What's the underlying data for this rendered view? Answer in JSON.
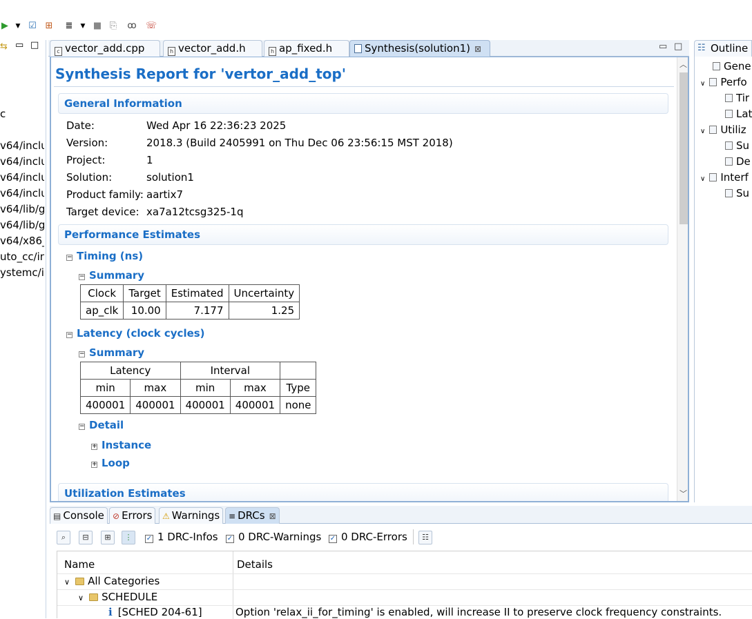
{
  "toolbar": {
    "run_icon": "▶",
    "dropdown_icon": "▼",
    "check_icon": "☑",
    "grid_icon": "⊞",
    "report_icon": "≣",
    "stop_icon": "■",
    "compare_icon": "⎘",
    "glasses_icon": "ꝏ",
    "chat_icon": "☏"
  },
  "left_pane": {
    "lines": [
      "c",
      "v64/inclu",
      "v64/inclu",
      "v64/inclu",
      "v64/inclu",
      "v64/lib/g",
      "v64/lib/g",
      "v64/x86_",
      "uto_cc/in",
      "ystemc/ir"
    ]
  },
  "editor_tabs": [
    {
      "label": "vector_add.cpp",
      "icon": "c"
    },
    {
      "label": "vector_add.h",
      "icon": "h"
    },
    {
      "label": "ap_fixed.h",
      "icon": "h"
    },
    {
      "label": "Synthesis(solution1)",
      "icon": "report",
      "active": true
    }
  ],
  "report": {
    "title": "Synthesis Report for 'vertor_add_top'",
    "general": {
      "header": "General Information",
      "rows": [
        {
          "label": "Date:",
          "value": "Wed Apr 16 22:36:23 2025"
        },
        {
          "label": "Version:",
          "value": "2018.3 (Build 2405991 on Thu Dec 06 23:56:15 MST 2018)"
        },
        {
          "label": "Project:",
          "value": "1"
        },
        {
          "label": "Solution:",
          "value": "solution1"
        },
        {
          "label": "Product family:",
          "value": "aartix7"
        },
        {
          "label": "Target device:",
          "value": "xa7a12tcsg325-1q"
        }
      ]
    },
    "performance": {
      "header": "Performance Estimates",
      "timing_header": "Timing (ns)",
      "summary_label": "Summary",
      "timing_cols": [
        "Clock",
        "Target",
        "Estimated",
        "Uncertainty"
      ],
      "timing_row": [
        "ap_clk",
        "10.00",
        "7.177",
        "1.25"
      ],
      "latency_header": "Latency (clock cycles)",
      "latency_group_cols": [
        "Latency",
        "Interval"
      ],
      "latency_cols": [
        "min",
        "max",
        "min",
        "max",
        "Type"
      ],
      "latency_row": [
        "400001",
        "400001",
        "400001",
        "400001",
        "none"
      ],
      "detail_label": "Detail",
      "instance_label": "Instance",
      "loop_label": "Loop"
    },
    "utilization": {
      "header": "Utilization Estimates"
    }
  },
  "outline": {
    "tab_label": "Outline",
    "items": [
      {
        "label": "Gene"
      },
      {
        "label": "Perfo"
      },
      {
        "label": "Tir"
      },
      {
        "label": "Lat"
      },
      {
        "label": "Utiliz"
      },
      {
        "label": "Su"
      },
      {
        "label": "De"
      },
      {
        "label": "Interf"
      },
      {
        "label": "Su"
      }
    ]
  },
  "bottom_tabs": [
    {
      "label": "Console"
    },
    {
      "label": "Errors"
    },
    {
      "label": "Warnings"
    },
    {
      "label": "DRCs",
      "active": true
    }
  ],
  "drc_filters": [
    {
      "label": "1 DRC-Infos",
      "checked": true
    },
    {
      "label": "0 DRC-Warnings",
      "checked": true
    },
    {
      "label": "0 DRC-Errors",
      "checked": true
    }
  ],
  "drc_table": {
    "col_name": "Name",
    "col_details": "Details",
    "all_categories": "All Categories",
    "schedule": "SCHEDULE",
    "entry_id": "[SCHED 204-61]",
    "entry_details": "Option 'relax_ii_for_timing' is enabled, will increase II to preserve clock frequency constraints.",
    "info_icon": "i"
  },
  "colors": {
    "accent": "#1a6ec6",
    "tab_active": "#cfe0f3",
    "border": "#8fb0d6"
  }
}
